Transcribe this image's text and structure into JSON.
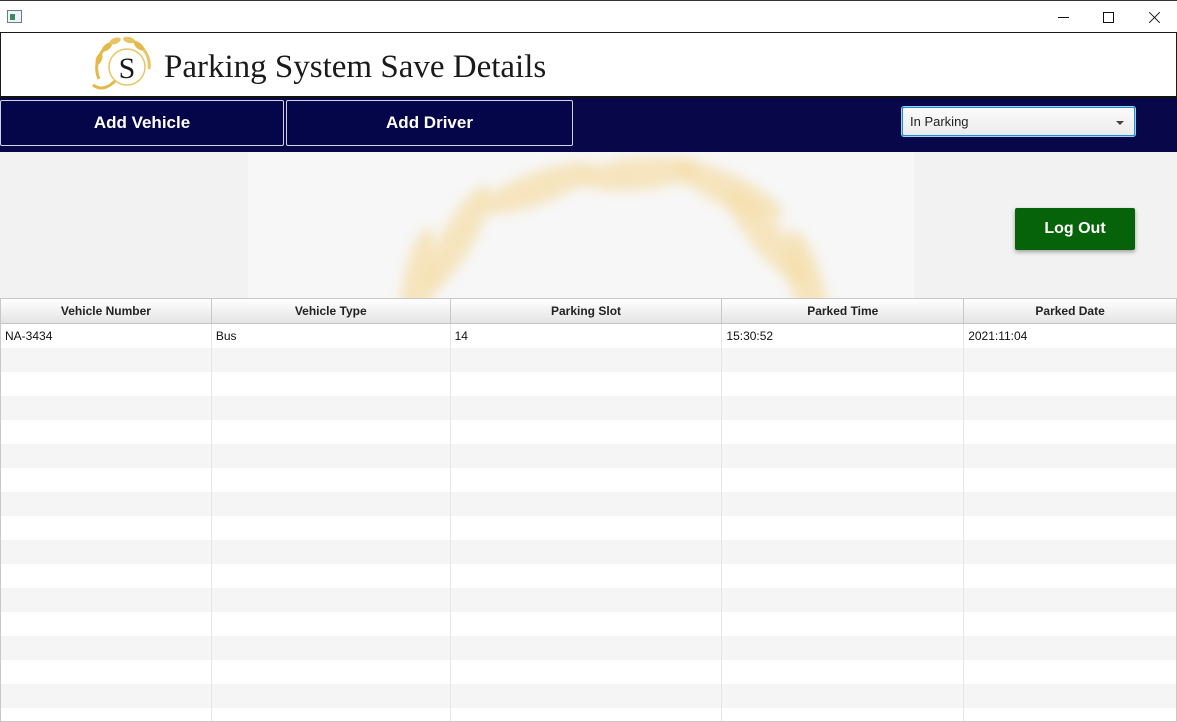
{
  "window": {
    "title": ""
  },
  "header": {
    "logo_letter": "S",
    "title": "Parking System Save Details"
  },
  "nav": {
    "add_vehicle_label": "Add Vehicle",
    "add_driver_label": "Add Driver",
    "status_select": {
      "selected": "In Parking"
    }
  },
  "actions": {
    "logout_label": "Log Out"
  },
  "table": {
    "columns": [
      "Vehicle Number",
      "Vehicle Type",
      "Parking Slot",
      "Parked Time",
      "Parked Date"
    ],
    "rows": [
      [
        "NA-3434",
        "Bus",
        "14",
        "15:30:52",
        "2021:11:04"
      ]
    ]
  },
  "colors": {
    "nav_background": "#07074a",
    "logout_button": "#06630a",
    "logo_gold": "#e3b94a",
    "select_focus": "#1f8fd6"
  }
}
